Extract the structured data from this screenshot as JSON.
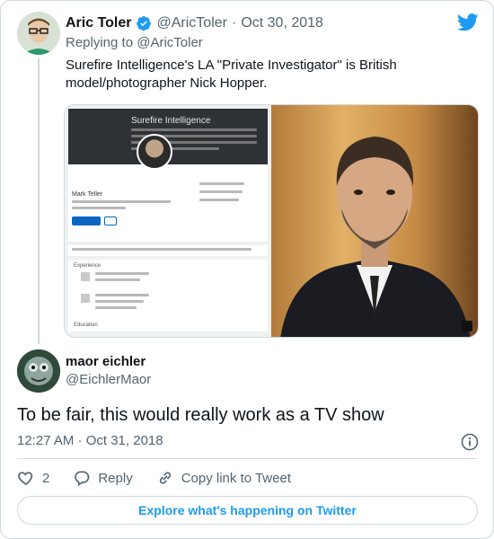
{
  "parent_tweet": {
    "author_name": "Aric Toler",
    "author_handle": "@AricToler",
    "separator": "·",
    "date": "Oct 30, 2018",
    "replying_label": "Replying to",
    "replying_handle": "@AricToler",
    "text": "Surefire Intelligence's LA \"Private Investigator\" is British model/photographer Nick Hopper."
  },
  "media": {
    "linkedin_header": "Surefire Intelligence",
    "linkedin_name": "Mark Teller",
    "experience_label": "Experience",
    "education_label": "Education"
  },
  "reply_tweet": {
    "author_name": "maor eichler",
    "author_handle": "@EichlerMaor",
    "text": "To be fair, this would really work as a TV show",
    "timestamp": "12:27 AM · Oct 31, 2018"
  },
  "actions": {
    "like_count": "2",
    "reply_label": "Reply",
    "copy_label": "Copy link to Tweet"
  },
  "explore_label": "Explore what's happening on Twitter",
  "colors": {
    "brand": "#1d9bf0",
    "text": "#0f1419",
    "muted": "#536471",
    "border": "#cfd9de"
  },
  "icons": [
    "verified-icon",
    "twitter-bird-icon",
    "info-icon",
    "heart-icon",
    "reply-icon",
    "link-icon"
  ]
}
